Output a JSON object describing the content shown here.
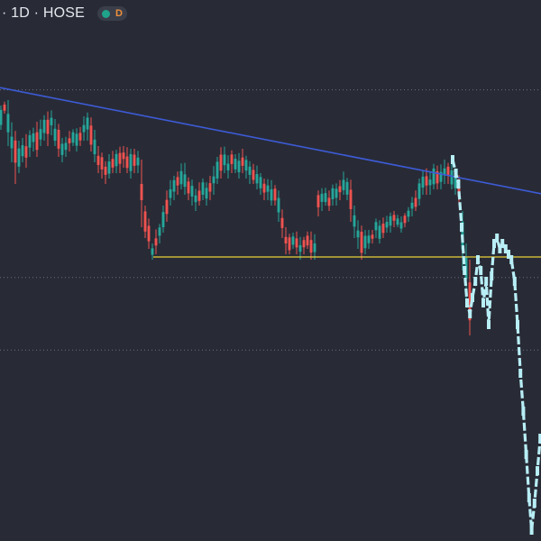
{
  "header": {
    "symbol_info": "· 1D · HOSE",
    "badge_letter": "D",
    "status_color": "#1fa38a",
    "badge_color": "#f0903a"
  },
  "colors": {
    "background": "#282b36",
    "up_candle": "#26a69a",
    "down_candle": "#ef5350",
    "trendline": "#3d5bd6",
    "support_line": "#e8d13a",
    "overlay_series": "#b8eef6",
    "gridline": "#6a6f7d"
  },
  "chart_data": {
    "type": "line",
    "description_type": "candlestick",
    "title": "",
    "xlabel": "",
    "ylabel": "",
    "xlim": [
      0,
      150
    ],
    "ylim": [
      0,
      100
    ],
    "grid": "horizontal-dotted",
    "levels": [
      83.4,
      48.7,
      35.3
    ],
    "trendline": {
      "x": [
        0,
        150
      ],
      "y": [
        83.8,
        64.2
      ]
    },
    "support": {
      "x": [
        42.5,
        150
      ],
      "y": [
        52.5,
        52.5
      ]
    },
    "series": [
      {
        "kind": "candles",
        "values": [
          [
            0,
            76,
            80.5
          ],
          [
            1,
            79,
            81.2
          ],
          [
            2,
            73,
            81.5
          ],
          [
            3,
            70,
            77.4
          ],
          [
            4,
            66,
            75.8
          ],
          [
            5,
            68,
            74
          ],
          [
            6,
            70,
            74.5
          ],
          [
            7,
            69,
            75.2
          ],
          [
            8,
            71,
            75.9
          ],
          [
            9,
            72,
            76.4
          ],
          [
            10,
            71,
            77.5
          ],
          [
            11,
            73,
            77.9
          ],
          [
            12,
            74,
            78.7
          ],
          [
            13,
            73,
            79.4
          ],
          [
            14,
            75,
            79.6
          ],
          [
            15,
            73,
            78
          ],
          [
            16,
            71,
            77.1
          ],
          [
            17,
            70,
            74.5
          ],
          [
            18,
            71,
            74.7
          ],
          [
            19,
            72,
            75.8
          ],
          [
            20,
            73,
            76.1
          ],
          [
            21,
            72,
            76.3
          ],
          [
            22,
            73,
            76.5
          ],
          [
            23,
            74,
            78.5
          ],
          [
            24,
            74,
            79.2
          ],
          [
            25,
            72,
            78.3
          ],
          [
            26,
            70,
            76
          ],
          [
            27,
            68,
            73
          ],
          [
            28,
            67,
            71.8
          ],
          [
            29,
            66,
            70.2
          ],
          [
            30,
            67,
            71.5
          ],
          [
            31,
            68,
            72.1
          ],
          [
            32,
            68,
            72.3
          ],
          [
            33,
            68,
            72.9
          ],
          [
            34,
            69,
            73
          ],
          [
            35,
            68,
            72.8
          ],
          [
            36,
            67,
            72.5
          ],
          [
            37,
            68,
            72.5
          ],
          [
            38,
            68,
            72.1
          ],
          [
            39,
            58,
            70.5
          ],
          [
            40,
            56,
            62
          ],
          [
            41,
            54,
            59.6
          ],
          [
            42,
            52,
            55
          ],
          [
            43,
            53,
            57.6
          ],
          [
            44,
            55,
            58.6
          ],
          [
            45,
            57,
            62
          ],
          [
            46,
            59,
            64.8
          ],
          [
            47,
            62,
            66.7
          ],
          [
            48,
            63,
            67.5
          ],
          [
            49,
            64,
            68.3
          ],
          [
            50,
            65,
            69.8
          ],
          [
            51,
            64,
            69.9
          ],
          [
            52,
            63,
            67.2
          ],
          [
            53,
            62,
            66.8
          ],
          [
            54,
            61,
            65.1
          ],
          [
            55,
            62,
            66.3
          ],
          [
            56,
            63,
            67
          ],
          [
            57,
            62,
            66.3
          ],
          [
            58,
            63,
            67.5
          ],
          [
            59,
            64,
            69.3
          ],
          [
            60,
            66,
            71
          ],
          [
            61,
            67,
            72.8
          ],
          [
            62,
            68,
            72.9
          ],
          [
            63,
            67,
            71.3
          ],
          [
            64,
            68,
            72.2
          ],
          [
            65,
            68,
            71.5
          ],
          [
            66,
            67,
            71.7
          ],
          [
            67,
            68,
            72.5
          ],
          [
            68,
            67,
            71.2
          ],
          [
            69,
            66,
            70.2
          ],
          [
            70,
            66,
            69.7
          ],
          [
            71,
            65,
            69.4
          ],
          [
            72,
            64,
            68
          ],
          [
            73,
            63,
            67
          ],
          [
            74,
            63,
            66.9
          ],
          [
            75,
            62,
            66.7
          ],
          [
            76,
            62,
            65.8
          ],
          [
            77,
            59,
            64.8
          ],
          [
            78,
            56,
            61.3
          ],
          [
            79,
            53,
            58
          ],
          [
            80,
            53,
            56.8
          ],
          [
            81,
            54,
            57
          ],
          [
            82,
            53,
            57.2
          ],
          [
            83,
            52,
            56.2
          ],
          [
            84,
            53,
            56.2
          ],
          [
            85,
            54,
            57.2
          ],
          [
            86,
            52,
            57.2
          ],
          [
            87,
            52,
            56.7
          ],
          [
            88,
            60,
            64.8
          ],
          [
            89,
            61,
            65.2
          ],
          [
            90,
            62,
            65.3
          ],
          [
            91,
            61,
            64.8
          ],
          [
            92,
            62,
            65.9
          ],
          [
            93,
            62,
            66.1
          ],
          [
            94,
            63,
            66.7
          ],
          [
            95,
            64,
            68.3
          ],
          [
            96,
            63,
            67.1
          ],
          [
            97,
            59,
            66.8
          ],
          [
            98,
            56,
            62
          ],
          [
            99,
            54,
            59.3
          ],
          [
            100,
            52,
            58.3
          ],
          [
            101,
            53,
            57.5
          ],
          [
            102,
            54,
            57.5
          ],
          [
            103,
            55,
            57.5
          ],
          [
            104,
            56,
            59.6
          ],
          [
            105,
            55,
            59.3
          ],
          [
            106,
            56,
            59.8
          ],
          [
            107,
            57,
            60.1
          ],
          [
            108,
            57,
            60.7
          ],
          [
            109,
            58,
            61
          ],
          [
            110,
            58,
            60.3
          ],
          [
            111,
            57,
            60
          ],
          [
            112,
            58,
            60.6
          ],
          [
            113,
            59,
            61.7
          ],
          [
            114,
            60,
            63.6
          ],
          [
            115,
            61,
            64.8
          ],
          [
            116,
            62,
            67
          ],
          [
            117,
            64,
            68.4
          ],
          [
            118,
            64,
            68.9
          ],
          [
            119,
            64,
            68.4
          ],
          [
            120,
            65,
            69.7
          ],
          [
            121,
            65,
            69.4
          ],
          [
            122,
            65,
            69.6
          ],
          [
            123,
            66,
            70.5
          ],
          [
            124,
            66,
            69.9
          ],
          [
            125,
            65,
            69.6
          ],
          [
            126,
            64,
            68.9
          ],
          [
            127,
            62,
            67.6
          ],
          [
            128,
            50,
            61
          ],
          [
            129,
            44,
            55
          ],
          [
            130,
            38,
            52
          ]
        ]
      },
      {
        "kind": "overlay",
        "values": [
          [
            125.5,
            70.5
          ],
          [
            126.4,
            68
          ],
          [
            127.1,
            66
          ],
          [
            128,
            58
          ],
          [
            128.8,
            50
          ],
          [
            129.5,
            44
          ],
          [
            130.3,
            42
          ],
          [
            131,
            45
          ],
          [
            131.8,
            48
          ],
          [
            132.5,
            52
          ],
          [
            133.3,
            50
          ],
          [
            134,
            44
          ],
          [
            134.8,
            48
          ],
          [
            135.5,
            40
          ],
          [
            136.3,
            49
          ],
          [
            137,
            55
          ],
          [
            137.8,
            56
          ],
          [
            138.6,
            54
          ],
          [
            139.3,
            55
          ],
          [
            140.2,
            54
          ],
          [
            141,
            53
          ],
          [
            141.8,
            52
          ],
          [
            142.7,
            48
          ],
          [
            143.5,
            40
          ],
          [
            144.3,
            31
          ],
          [
            145.1,
            24
          ],
          [
            145.9,
            16
          ],
          [
            146.7,
            8
          ],
          [
            147.4,
            2
          ],
          [
            148.2,
            7
          ],
          [
            149,
            13
          ],
          [
            149.8,
            19
          ]
        ]
      }
    ]
  }
}
